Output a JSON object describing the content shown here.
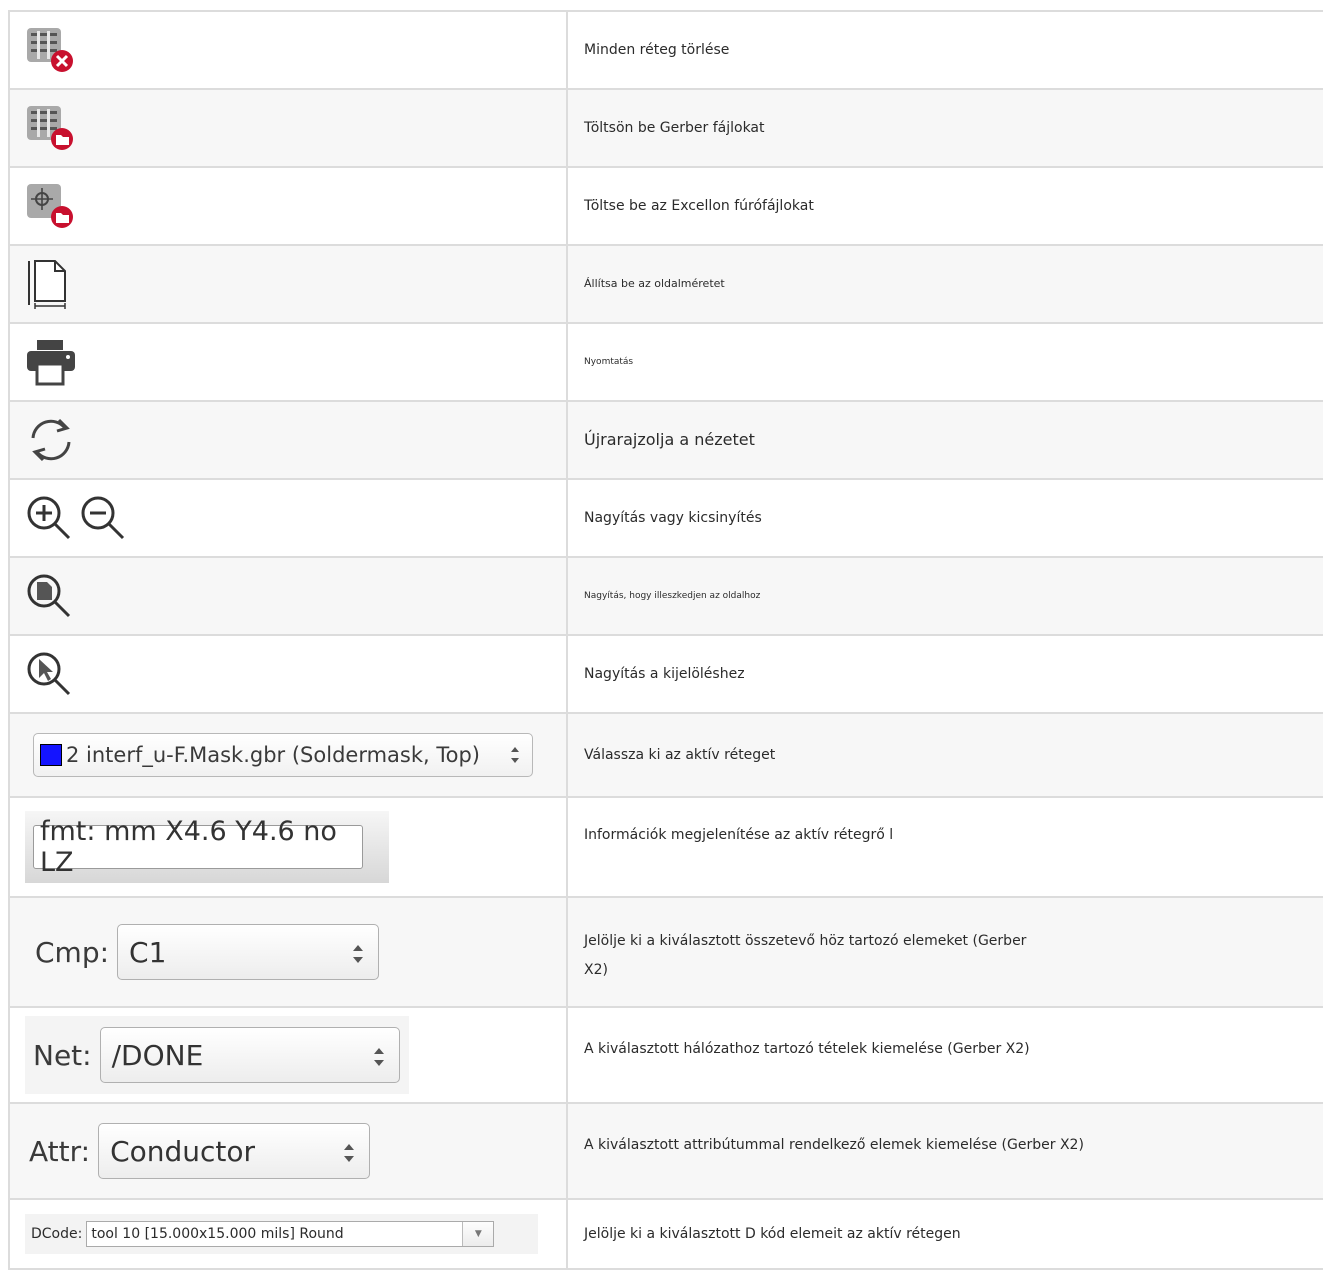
{
  "rows": [
    {
      "icon": "clear-layers-icon",
      "text": "Minden réteg törlése"
    },
    {
      "icon": "load-gerber-icon",
      "text": "Töltsön be Gerber fájlokat"
    },
    {
      "icon": "load-drill-icon",
      "text": "Töltse be az Excellon fúrófájlokat"
    },
    {
      "icon": "page-size-icon",
      "text": "Állítsa be az oldalméretet"
    },
    {
      "icon": "print-icon",
      "text": "Nyomtatás"
    },
    {
      "icon": "redraw-icon",
      "text": "Újrarajzolja a nézetet"
    },
    {
      "icon": "zoom-in-out-icon",
      "text": "Nagyítás vagy kicsinyítés"
    },
    {
      "icon": "zoom-fit-icon",
      "text": "Nagyítás, hogy illeszkedjen az oldalhoz"
    },
    {
      "icon": "zoom-selection-icon",
      "text": "Nagyítás a kijelöléshez"
    },
    {
      "icon": "layer-select-widget",
      "text": "Válassza ki az aktív réteget"
    },
    {
      "icon": "layer-info-widget",
      "text": "Információk megjelenítése az aktív rétegrő l"
    },
    {
      "icon": "component-select-widget",
      "text": "Jelölje ki a kiválasztott összetevő höz tartozó elemeket (Gerber",
      "text2": "X2)"
    },
    {
      "icon": "net-select-widget",
      "text": "A kiválasztott hálózathoz tartozó tételek kiemelése (Gerber X2)"
    },
    {
      "icon": "attribute-select-widget",
      "text": "A kiválasztott attribútummal rendelkező  elemek kiemelése (Gerber X2)"
    },
    {
      "icon": "dcode-select-widget",
      "text": "Jelölje ki a kiválasztott D kód elemeit az aktív rétegen"
    }
  ],
  "widgets": {
    "layer": {
      "value": "2 interf_u-F.Mask.gbr (Soldermask, Top)",
      "swatch_color": "#1414ff"
    },
    "fmt": {
      "value": "fmt: mm X4.6 Y4.6 no LZ"
    },
    "cmp": {
      "label": "Cmp:",
      "value": "C1"
    },
    "net": {
      "label": "Net:",
      "value": "/DONE"
    },
    "attr": {
      "label": "Attr:",
      "value": "Conductor"
    },
    "dcode": {
      "label": "DCode:",
      "value": "tool 10 [15.000x15.000 mils] Round"
    }
  },
  "colors": {
    "border": "#dcdcdc",
    "accent_red": "#c8102e",
    "icon_grey": "#a9a9a9"
  }
}
